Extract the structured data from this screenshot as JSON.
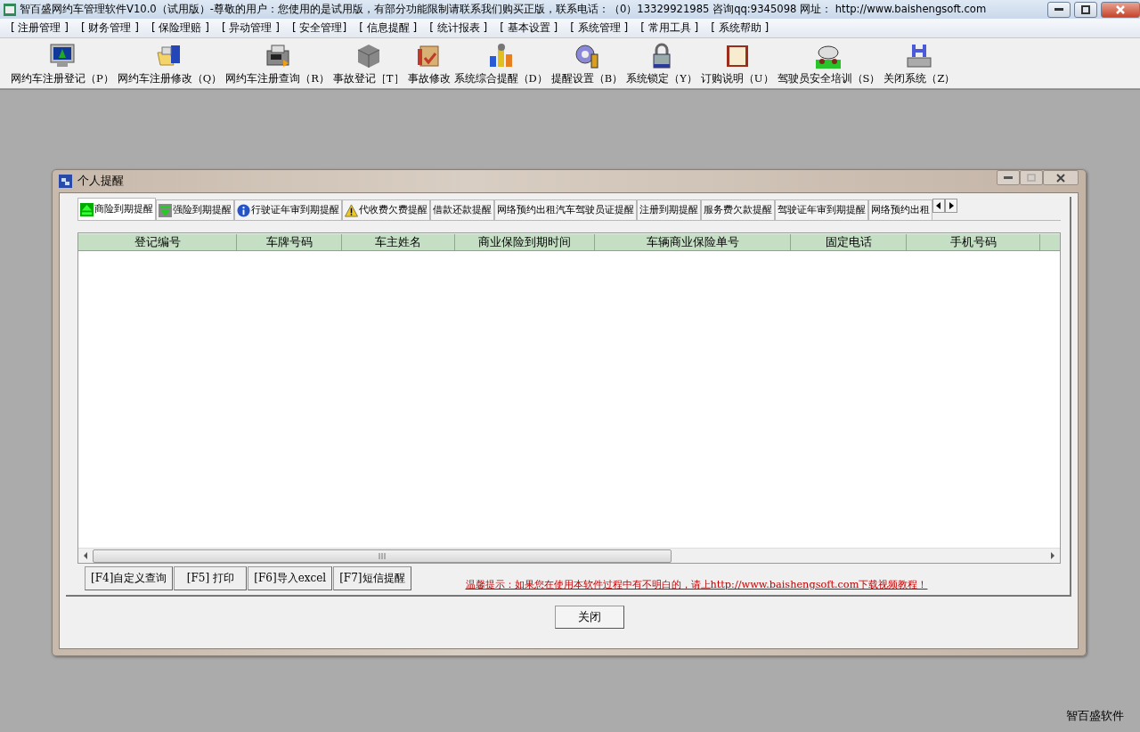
{
  "window": {
    "title": "智百盛网约车管理软件V10.0（试用版）-尊敬的用户：您使用的是试用版，有部分功能限制请联系我们购买正版，联系电话：（0）13329921985  咨询qq:9345098   网址：  http://www.baishengsoft.com"
  },
  "menu": [
    "[ 注册管理 ]",
    "[ 财务管理 ]",
    "[ 保险理赔 ]",
    "[ 异动管理 ]",
    "[ 安全管理]",
    "[ 信息提醒 ]",
    "[ 统计报表 ]",
    "[ 基本设置 ]",
    "[ 系统管理 ]",
    "[ 常用工具 ]",
    "[ 系统帮助 ]"
  ],
  "toolbar": [
    "网约车注册登记（P）",
    "网约车注册修改（Q）",
    "网约车注册查询（R）",
    "事故登记［T］",
    "事故修改",
    "系统综合提醒（D）",
    "提醒设置（B）",
    "系统锁定（Y）",
    "订购说明（U）",
    "驾驶员安全培训（S）",
    "关闭系统（Z）"
  ],
  "dialog": {
    "title": "个人提醒",
    "tabs": [
      {
        "label": "商险到期提醒",
        "selected": true
      },
      {
        "label": "强险到期提醒",
        "selected": false
      },
      {
        "label": "行驶证年审到期提醒",
        "selected": false
      },
      {
        "label": "代收费欠费提醒",
        "selected": false
      },
      {
        "label": "借款还款提醒",
        "selected": false
      },
      {
        "label": "网络预约出租汽车驾驶员证提醒",
        "selected": false
      },
      {
        "label": "注册到期提醒",
        "selected": false
      },
      {
        "label": "服务费欠款提醒",
        "selected": false
      },
      {
        "label": "驾驶证年审到期提醒",
        "selected": false
      },
      {
        "label": "网络预约出租",
        "selected": false
      }
    ],
    "table": {
      "columns": [
        "登记编号",
        "车牌号码",
        "车主姓名",
        "商业保险到期时间",
        "车辆商业保险单号",
        "固定电话",
        "手机号码"
      ]
    },
    "buttons": [
      "[F4]自定义查询",
      "[F5] 打印",
      "[F6]导入excel",
      "[F7]短信提醒"
    ],
    "hint": "温馨提示：如果您在使用本软件过程中有不明白的，请上http://www.baishengsoft.com下载视频教程！",
    "close_button": "关闭"
  },
  "footer": "智百盛软件"
}
